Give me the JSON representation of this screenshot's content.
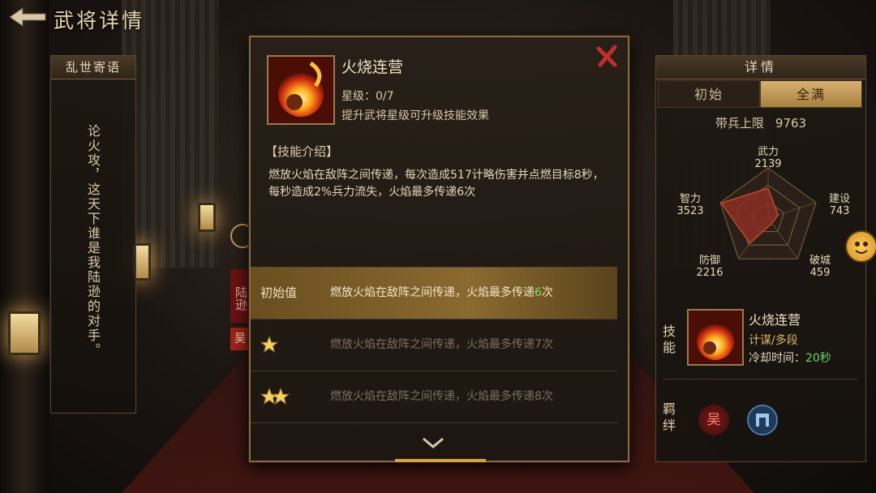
{
  "header": {
    "title": "武将详情"
  },
  "poem": {
    "header": "乱世寄语",
    "text": "论火攻，这天下谁是我陆逊的对手。"
  },
  "side": {
    "name_chars": "陆逊",
    "faction": "吴"
  },
  "modal": {
    "skill_name": "火烧连营",
    "star_level": "星级：0/7",
    "star_hint": "提升武将星级可升级技能效果",
    "section_heading": "【技能介绍】",
    "description": "燃放火焰在敌阵之间传递，每次造成517计略伤害并点燃目标8秒，每秒造成2%兵力流失，火焰最多传递6次",
    "rows": [
      {
        "label": "初始值",
        "text_prefix": "燃放火焰在敌阵之间传递，火焰最多传递",
        "highlight": "6",
        "text_suffix": "次",
        "stars": 0
      },
      {
        "label": "",
        "text": "燃放火焰在敌阵之间传递，火焰最多传递7次",
        "stars": 1
      },
      {
        "label": "",
        "text": "燃放火焰在敌阵之间传递，火焰最多传递8次",
        "stars": 2
      }
    ]
  },
  "details": {
    "header": "详情",
    "tabs": [
      "初始",
      "全满"
    ],
    "active_tab": "全满",
    "troops_label": "带兵上限",
    "troops_value": "9763",
    "stats": [
      {
        "name": "武力",
        "value": "2139"
      },
      {
        "name": "建设",
        "value": "743"
      },
      {
        "name": "破城",
        "value": "459"
      },
      {
        "name": "防御",
        "value": "2216"
      },
      {
        "name": "智力",
        "value": "3523"
      }
    ],
    "skill_section_label": "技能",
    "skill": {
      "name": "火烧连营",
      "type": "计谋/多段",
      "cooldown_label": "冷却时间：",
      "cooldown_value": "20秒"
    },
    "bond_section_label": "羁绊",
    "bond_wu": "吴"
  },
  "colors": {
    "accent": "#c8a060",
    "highlight_green": "#7ee060",
    "close_red": "#c0302a"
  }
}
